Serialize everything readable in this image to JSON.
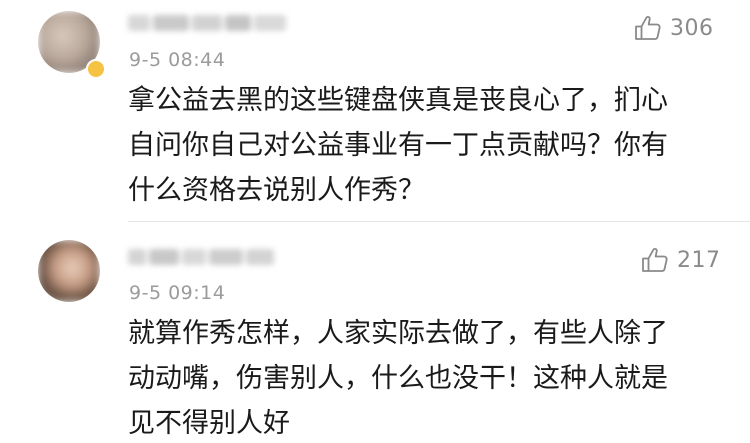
{
  "comments": [
    {
      "time": "9-5 08:44",
      "likes": "306",
      "text_lines": [
        "拿公益去黑的这些键盘侠真是丧良心了，扪心",
        "自问你自己对公益事业有一丁点贡献吗？你有",
        "什么资格去说别人作秀？"
      ]
    },
    {
      "time": "9-5 09:14",
      "likes": "217",
      "text_lines": [
        "就算作秀怎样，人家实际去做了，有些人除了",
        "动动嘴，伤害别人，什么也没干！这种人就是",
        "见不得别人好"
      ]
    }
  ],
  "icons": {
    "like": "thumbs-up-outline-icon",
    "verified": "verified-badge-icon"
  },
  "colors": {
    "text": "#1a1a1a",
    "meta": "#9b9b9b",
    "divider": "#e6e6e6",
    "badge": "#f6c244"
  }
}
